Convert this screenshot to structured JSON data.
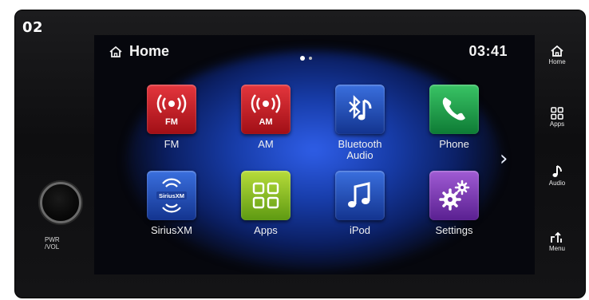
{
  "figure_label": "02",
  "status_bar": {
    "title": "Home",
    "time": "03:41",
    "pages": 2,
    "active_page": 1
  },
  "apps": [
    {
      "label": "FM",
      "icon": "fm-radio-icon",
      "color": "#c81e25"
    },
    {
      "label": "AM",
      "icon": "am-radio-icon",
      "color": "#c81e25"
    },
    {
      "label": "Bluetooth Audio",
      "icon": "bluetooth-audio-icon",
      "color": "#2a56c6"
    },
    {
      "label": "Phone",
      "icon": "phone-icon",
      "color": "#23a24d"
    },
    {
      "label": "SiriusXM",
      "icon": "siriusxm-icon",
      "color": "#2a56c6"
    },
    {
      "label": "Apps",
      "icon": "apps-grid-icon",
      "color": "#8cc22a"
    },
    {
      "label": "iPod",
      "icon": "music-note-icon",
      "color": "#2a56c6"
    },
    {
      "label": "Settings",
      "icon": "gears-icon",
      "color": "#7c3bb4"
    }
  ],
  "icon_text": {
    "fm": "FM",
    "am": "AM",
    "sirius": "SiriusXM"
  },
  "side_buttons": [
    {
      "label": "Home",
      "icon": "home-icon"
    },
    {
      "label": "Apps",
      "icon": "apps-icon"
    },
    {
      "label": "Audio",
      "icon": "audio-icon"
    },
    {
      "label": "Menu",
      "icon": "menu-icon"
    }
  ],
  "knob_label_line1": "PWR",
  "knob_label_line2": "/VOL",
  "next_page_icon": "chevron-right-icon"
}
